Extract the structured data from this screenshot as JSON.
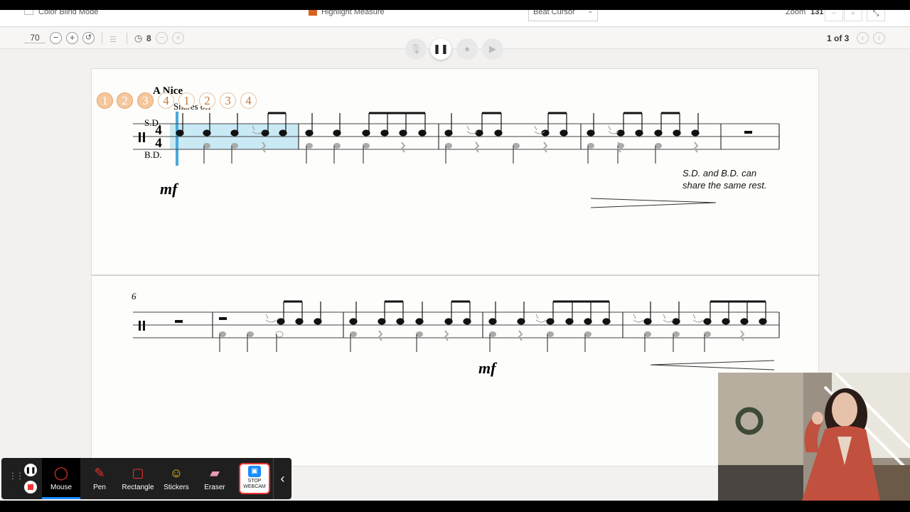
{
  "topbar": {
    "color_blind_label": "Color Blind Mode",
    "highlight_label": "Highlight Measure",
    "cursor_select": "Beat Cursor",
    "zoom_label": "Zoom",
    "zoom_value": "131",
    "zoom_minus": "−",
    "zoom_plus": "+",
    "fullscreen": "⤡"
  },
  "toolbar": {
    "tempo_value": "70",
    "minus": "−",
    "plus": "+",
    "reset": "↺",
    "clock_icon": "◷",
    "countoff": "8",
    "page_indicator": "1 of 3",
    "prev": "‹",
    "next": "›"
  },
  "playback": {
    "mic": "🎙",
    "pause": "❚❚",
    "record": "●",
    "forward": "▶"
  },
  "beat_counts": [
    "1",
    "2",
    "3",
    "4",
    "1",
    "2",
    "3",
    "4"
  ],
  "score": {
    "title": "A Nice",
    "snares_off": "Snares off",
    "sd_label": "S.D.",
    "bd_label": "B.D.",
    "time_sig_top": "4",
    "time_sig_bottom": "4",
    "dynamic_1": "mf",
    "dynamic_2": "mf",
    "rest_note_1": "S.D. and B.D. can",
    "rest_note_2": "share the same rest.",
    "measure_number": "6"
  },
  "drawing_toolbar": {
    "tools": [
      {
        "label": "Mouse"
      },
      {
        "label": "Pen"
      },
      {
        "label": "Rectangle"
      },
      {
        "label": "Stickers"
      },
      {
        "label": "Eraser"
      }
    ],
    "stop_line1": "STOP",
    "stop_line2": "WEBCAM",
    "collapse": "‹"
  },
  "colors": {
    "highlight": "#c9e9f5",
    "cursor": "#4aa8dc",
    "accent": "#d9621c"
  }
}
